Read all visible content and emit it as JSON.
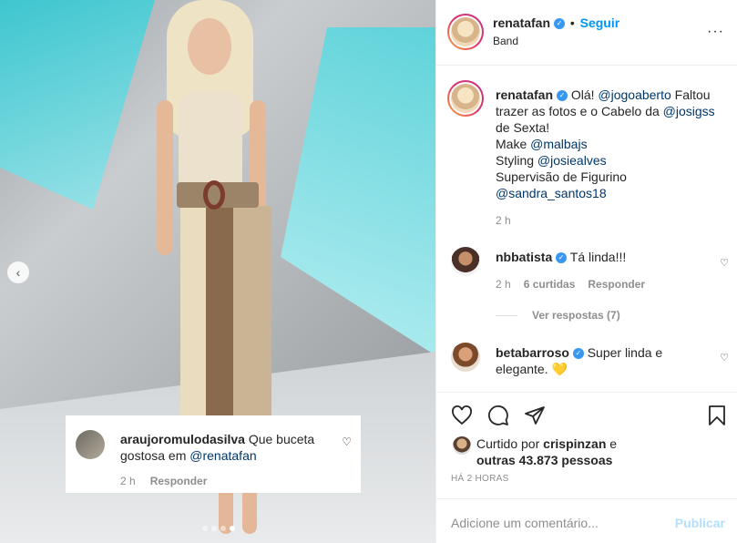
{
  "post": {
    "username": "renatafan",
    "follow_label": "Seguir",
    "location": "Band",
    "caption_lines": [
      "Olá! @jogoaberto Faltou",
      "trazer as fotos e o Cabelo da @josigss",
      "de Sexta!"
    ],
    "caption_parts": {
      "ola": "Olá!",
      "jogoaberto": "@jogoaberto",
      "faltou": "Faltou",
      "trazer": "trazer as fotos e o Cabelo da",
      "josigss": "@josigss",
      "sexta": "de Sexta!",
      "make": "Make",
      "malbajs": "@malbajs",
      "styling": "Styling",
      "josiealves": "@josiealves",
      "supervisao": "Supervisão de Figurino",
      "sandra": "@sandra_santos18"
    },
    "caption_time": "2 h"
  },
  "comments": [
    {
      "user": "nbbatista",
      "text": "Tá linda!!!",
      "time": "2 h",
      "likes": "6 curtidas",
      "reply": "Responder",
      "view_replies": "Ver respostas (7)"
    },
    {
      "user": "betabarroso",
      "text_a": "Super linda e",
      "text_b": "elegante. 💛"
    }
  ],
  "likes": {
    "prefix": "Curtido por",
    "user": "crispinzan",
    "and": "e",
    "others": "outras 43.873 pessoas"
  },
  "timestamp": "HÁ 2 HORAS",
  "add_comment": {
    "placeholder": "Adicione um comentário...",
    "publish": "Publicar"
  },
  "photo_tag": {
    "user": "araujoromulodasilva",
    "text_a": "Que buceta",
    "text_b": "gostosa em",
    "mention": "@renatafan",
    "time": "2 h",
    "reply": "Responder"
  },
  "icons": {
    "more": "more-options-icon",
    "heart": "heart-icon",
    "comment": "comment-icon",
    "share": "share-icon",
    "save": "bookmark-icon"
  }
}
